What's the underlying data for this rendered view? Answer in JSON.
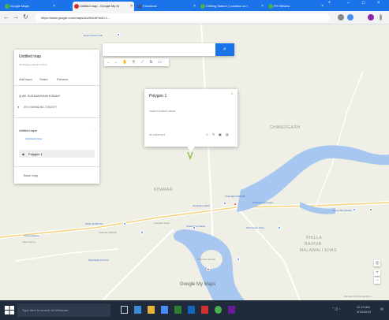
{
  "browser": {
    "tabs": [
      {
        "title": "Google Maps",
        "active": false
      },
      {
        "title": "Untitled map - Google My M",
        "active": true
      },
      {
        "title": "Facebook",
        "active": false
      },
      {
        "title": "Chilling Station | Location on t",
        "active": false
      },
      {
        "title": "PH Hillview",
        "active": false
      }
    ],
    "url": "https://www.google.com/maps/d/u/0/edit?mid=1..."
  },
  "map": {
    "title": "Untitled map",
    "subtitle": "All changes saved to Drive",
    "actions": [
      "Add layer",
      "Share",
      "Preview"
    ],
    "layer_search": "Q AK SUSSANGAIN KISANY",
    "pin_label": "29.0 54962,80.7192477",
    "layer_title": "Untitled layer",
    "layer_style": "Individual styles",
    "layer_item": "Polygon 1",
    "base_map": "Base map",
    "info_title": "Polygon 1",
    "info_desc": "ALWAYS KISANY ROAD",
    "info_coords": "55 3 AB  B  63 9",
    "area_labels": {
      "big1": "CHANDIGARH",
      "big2": "BHUSTY",
      "big3": "KHARAR",
      "big4": "PHILLA",
      "big5": "RAIPUR",
      "big6": "MALAWALI KHAS"
    },
    "place_labels": [
      "Hotel Sunset Club",
      "Chandigarh Bibi Ba",
      "Sadhumangra Rope",
      "NICE HOSPITAL",
      "KARTEK BAZAR",
      "Prasad Market",
      "SGS Super Store",
      "Chandigarh Saran",
      "Green Bar Market",
      "Gurdwara Sahib",
      "Shambha Mandir",
      "Panchkula Tribunal",
      "Indra Colony",
      "Cascade Road"
    ],
    "google_logo": "Google My Maps",
    "footer": "Map data ©2019 Google  Terms"
  },
  "taskbar": {
    "search_placeholder": "Type here to search for Windows",
    "time": "11:19 AM",
    "date": "4/19/2019"
  },
  "colors": {
    "accent": "#1a73e8",
    "river": "#a8c7f0",
    "map_bg": "#efefe6",
    "taskbar": "#1f2a3a"
  }
}
